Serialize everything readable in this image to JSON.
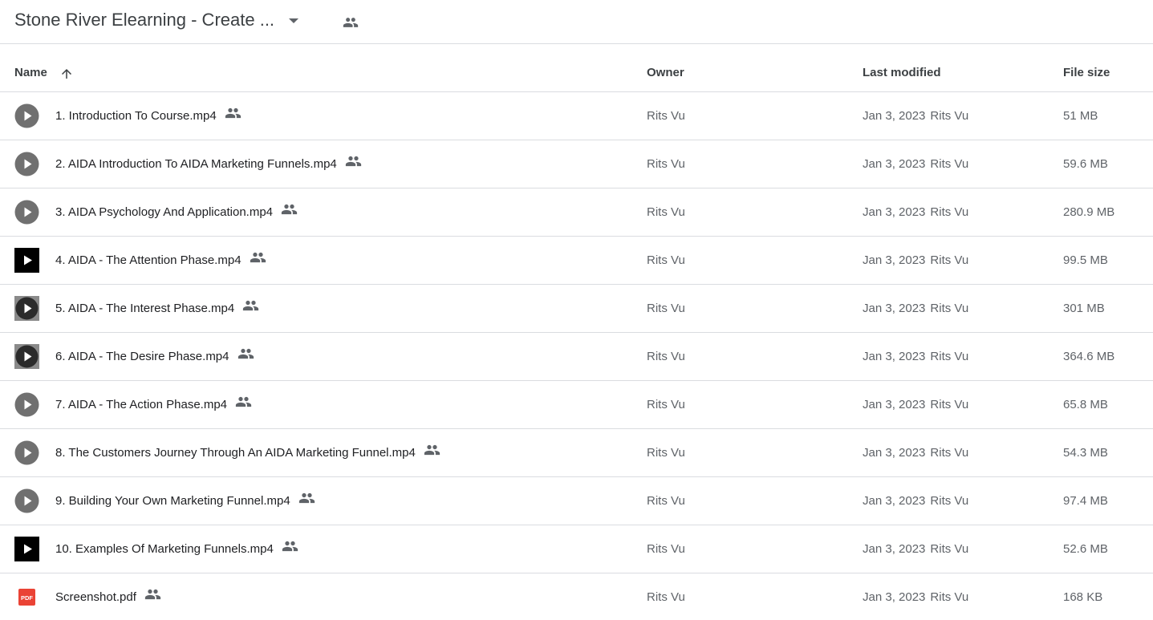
{
  "folder": {
    "title": "Stone River Elearning - Create ...",
    "shared_icon": "people-icon",
    "dropdown_icon": "caret-down-icon"
  },
  "columns": {
    "name": "Name",
    "owner": "Owner",
    "last_modified": "Last modified",
    "file_size": "File size",
    "sort_icon": "arrow-up-icon"
  },
  "colors": {
    "pdf_red": "#ea4335",
    "video_gray": "#6f6f6f",
    "text": "#3c4043",
    "divider": "#dadce0"
  },
  "files": [
    {
      "name": "1. Introduction To Course.mp4",
      "type": "video",
      "thumb": "gray-circle",
      "owner": "Rits Vu",
      "modified_date": "Jan 3, 2023",
      "modified_by": "Rits Vu",
      "size": "51 MB"
    },
    {
      "name": "2. AIDA Introduction To AIDA Marketing Funnels.mp4",
      "type": "video",
      "thumb": "gray-circle",
      "owner": "Rits Vu",
      "modified_date": "Jan 3, 2023",
      "modified_by": "Rits Vu",
      "size": "59.6 MB"
    },
    {
      "name": "3. AIDA Psychology And Application.mp4",
      "type": "video",
      "thumb": "gray-circle",
      "owner": "Rits Vu",
      "modified_date": "Jan 3, 2023",
      "modified_by": "Rits Vu",
      "size": "280.9 MB"
    },
    {
      "name": "4. AIDA - The Attention Phase.mp4",
      "type": "video",
      "thumb": "black-square",
      "owner": "Rits Vu",
      "modified_date": "Jan 3, 2023",
      "modified_by": "Rits Vu",
      "size": "99.5 MB"
    },
    {
      "name": "5. AIDA - The Interest Phase.mp4",
      "type": "video",
      "thumb": "gray-square",
      "owner": "Rits Vu",
      "modified_date": "Jan 3, 2023",
      "modified_by": "Rits Vu",
      "size": "301 MB"
    },
    {
      "name": "6. AIDA - The Desire Phase.mp4",
      "type": "video",
      "thumb": "gray-square",
      "owner": "Rits Vu",
      "modified_date": "Jan 3, 2023",
      "modified_by": "Rits Vu",
      "size": "364.6 MB"
    },
    {
      "name": "7. AIDA - The Action Phase.mp4",
      "type": "video",
      "thumb": "gray-circle",
      "owner": "Rits Vu",
      "modified_date": "Jan 3, 2023",
      "modified_by": "Rits Vu",
      "size": "65.8 MB"
    },
    {
      "name": "8. The Customers Journey Through An AIDA Marketing Funnel.mp4",
      "type": "video",
      "thumb": "gray-circle",
      "owner": "Rits Vu",
      "modified_date": "Jan 3, 2023",
      "modified_by": "Rits Vu",
      "size": "54.3 MB"
    },
    {
      "name": "9. Building Your Own Marketing Funnel.mp4",
      "type": "video",
      "thumb": "gray-circle",
      "owner": "Rits Vu",
      "modified_date": "Jan 3, 2023",
      "modified_by": "Rits Vu",
      "size": "97.4 MB"
    },
    {
      "name": "10. Examples Of Marketing Funnels.mp4",
      "type": "video",
      "thumb": "black-square",
      "owner": "Rits Vu",
      "modified_date": "Jan 3, 2023",
      "modified_by": "Rits Vu",
      "size": "52.6 MB"
    },
    {
      "name": "Screenshot.pdf",
      "type": "pdf",
      "thumb": "pdf",
      "owner": "Rits Vu",
      "modified_date": "Jan 3, 2023",
      "modified_by": "Rits Vu",
      "size": "168 KB",
      "pdf_label": "PDF"
    }
  ]
}
